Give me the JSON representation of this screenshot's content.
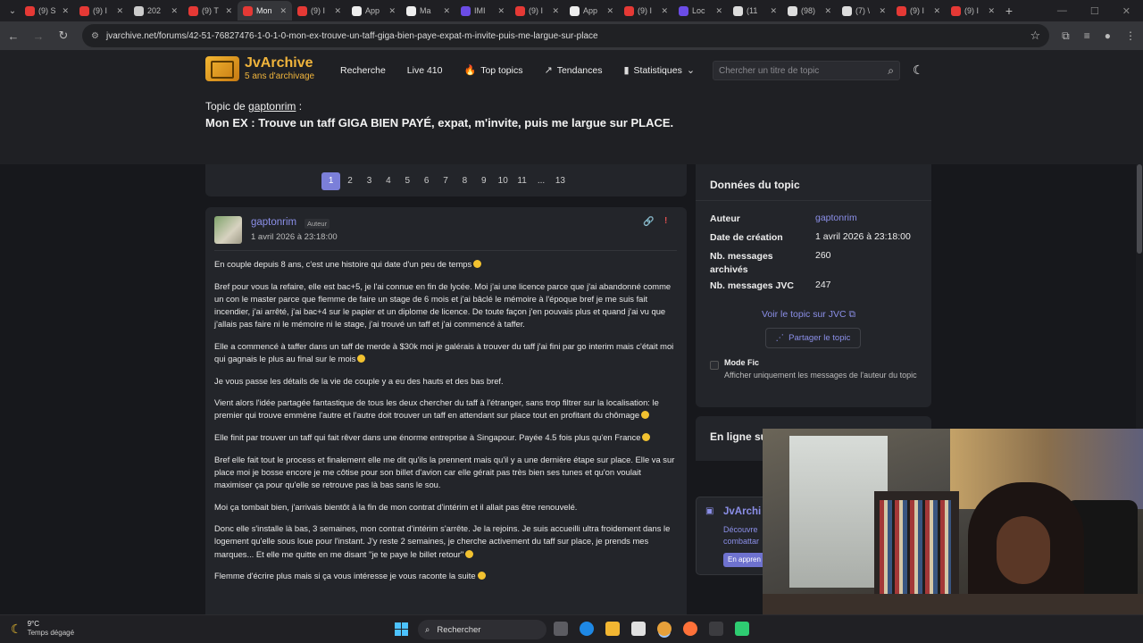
{
  "browser": {
    "tabs": [
      {
        "label": "(9) S",
        "color": "#e53935"
      },
      {
        "label": "(9) I",
        "color": "#e53935"
      },
      {
        "label": "202",
        "color": "#cccccc"
      },
      {
        "label": "(9) T",
        "color": "#e53935"
      },
      {
        "label": "Mon",
        "color": "#e53935",
        "active": true
      },
      {
        "label": "(9) I",
        "color": "#e53935"
      },
      {
        "label": "App",
        "color": "#eeeeee"
      },
      {
        "label": "Ma",
        "color": "#eeeeee"
      },
      {
        "label": "IMI",
        "color": "#6b4ce6"
      },
      {
        "label": "(9) I",
        "color": "#e53935"
      },
      {
        "label": "App",
        "color": "#eeeeee"
      },
      {
        "label": "(9) I",
        "color": "#e53935"
      },
      {
        "label": "Loc",
        "color": "#6b4ce6"
      },
      {
        "label": "(11",
        "color": "#dddddd"
      },
      {
        "label": "(98)",
        "color": "#dddddd"
      },
      {
        "label": "(7) \\",
        "color": "#dddddd"
      },
      {
        "label": "(9) I",
        "color": "#e53935"
      },
      {
        "label": "(9) I",
        "color": "#e53935"
      }
    ],
    "url": "jvarchive.net/forums/42-51-76827476-1-0-1-0-mon-ex-trouve-un-taff-giga-bien-paye-expat-m-invite-puis-me-largue-sur-place"
  },
  "site": {
    "logo_title": "JvArchive",
    "logo_subtitle": "5 ans d'archivage",
    "nav": {
      "recherche": "Recherche",
      "live": "Live 410",
      "top_topics": "Top topics",
      "tendances": "Tendances",
      "statistiques": "Statistiques"
    },
    "search_placeholder": "Chercher un titre de topic"
  },
  "topic": {
    "label_prefix": "Topic de",
    "author": "gaptonrim",
    "label_suffix": " :",
    "title": "Mon EX : Trouve un taff GIGA BIEN PAYÉ, expat, m'invite, puis me largue sur PLACE."
  },
  "pagination": {
    "pages": [
      "1",
      "2",
      "3",
      "4",
      "5",
      "6",
      "7",
      "8",
      "9",
      "10",
      "11",
      "...",
      "13"
    ],
    "current": "1"
  },
  "post": {
    "author": "gaptonrim",
    "badge": "Auteur",
    "date": "1 avril 2026 à 23:18:00",
    "paragraphs": [
      "En couple depuis 8 ans, c'est une histoire qui date d'un peu de temps",
      "Bref pour vous la refaire, elle est bac+5, je l'ai connue en fin de lycée. Moi j'ai une licence parce que j'ai abandonné comme un con le master parce que flemme de faire un stage de 6 mois et j'ai bâclé le mémoire à l'époque bref je me suis fait incendier, j'ai arrêté, j'ai bac+4 sur le papier et un diplome de licence. De toute façon j'en pouvais plus et quand j'ai vu que j'allais pas faire ni le mémoire ni le stage, j'ai trouvé un taff et j'ai commencé à taffer.",
      "Elle a commencé à taffer dans un taff de merde à $30k moi je galérais à trouver du taff j'ai fini par go interim mais c'était moi qui gagnais le plus au final sur le mois",
      "Je vous passe les détails de la vie de couple y a eu des hauts et des bas bref.",
      "Vient alors l'idée partagée fantastique de tous les deux chercher du taff à l'étranger, sans trop filtrer sur la localisation: le premier qui trouve emmène l'autre et l'autre doit trouver un taff en attendant sur place tout en profitant du chômage",
      "Elle finit par trouver un taff qui fait rêver dans une énorme entreprise à Singapour. Payée 4.5 fois plus qu'en France",
      "Bref elle fait tout le process et finalement elle me dit qu'ils la prennent mais qu'il y a une dernière étape sur place. Elle va sur place moi je bosse encore je me côtise pour son billet d'avion car elle gérait pas très bien ses tunes et qu'on voulait maximiser ça pour qu'elle se retrouve pas là bas sans le sou.",
      "Moi ça tombait bien, j'arrivais bientôt à la fin de mon contrat d'intérim et il allait pas être renouvelé.",
      "Donc elle s'installe là bas, 3 semaines, mon contrat d'intérim s'arrête. Je la rejoins. Je suis accueilli ultra froidement dans le logement qu'elle sous loue pour l'instant. J'y reste 2 semaines, je cherche activement du taff sur place, je prends mes marques... Et elle me quitte en me disant \"je te paye le billet retour\"",
      "Flemme d'écrire plus mais si ça vous intéresse je vous raconte la suite"
    ]
  },
  "sidebar": {
    "title": "Données du topic",
    "rows": [
      {
        "key": "Auteur",
        "value": "gaptonrim"
      },
      {
        "key": "Date de création",
        "value": "1 avril 2026 à 23:18:00"
      },
      {
        "key": "Nb. messages archivés",
        "value": "260"
      },
      {
        "key": "Nb. messages JVC",
        "value": "247"
      }
    ],
    "jvc_link": "Voir le topic sur JVC",
    "share_button": "Partager le topic",
    "mode_fic_title": "Mode Fic",
    "mode_fic_desc": "Afficher uniquement les messages de l'auteur du topic",
    "online_title": "En ligne su",
    "promo": {
      "title": "JvArchi",
      "line1": "Découvre",
      "line2": "combattar",
      "button": "En appren"
    }
  },
  "taskbar": {
    "temp": "9°C",
    "weather": "Temps dégagé",
    "search": "Rechercher"
  }
}
